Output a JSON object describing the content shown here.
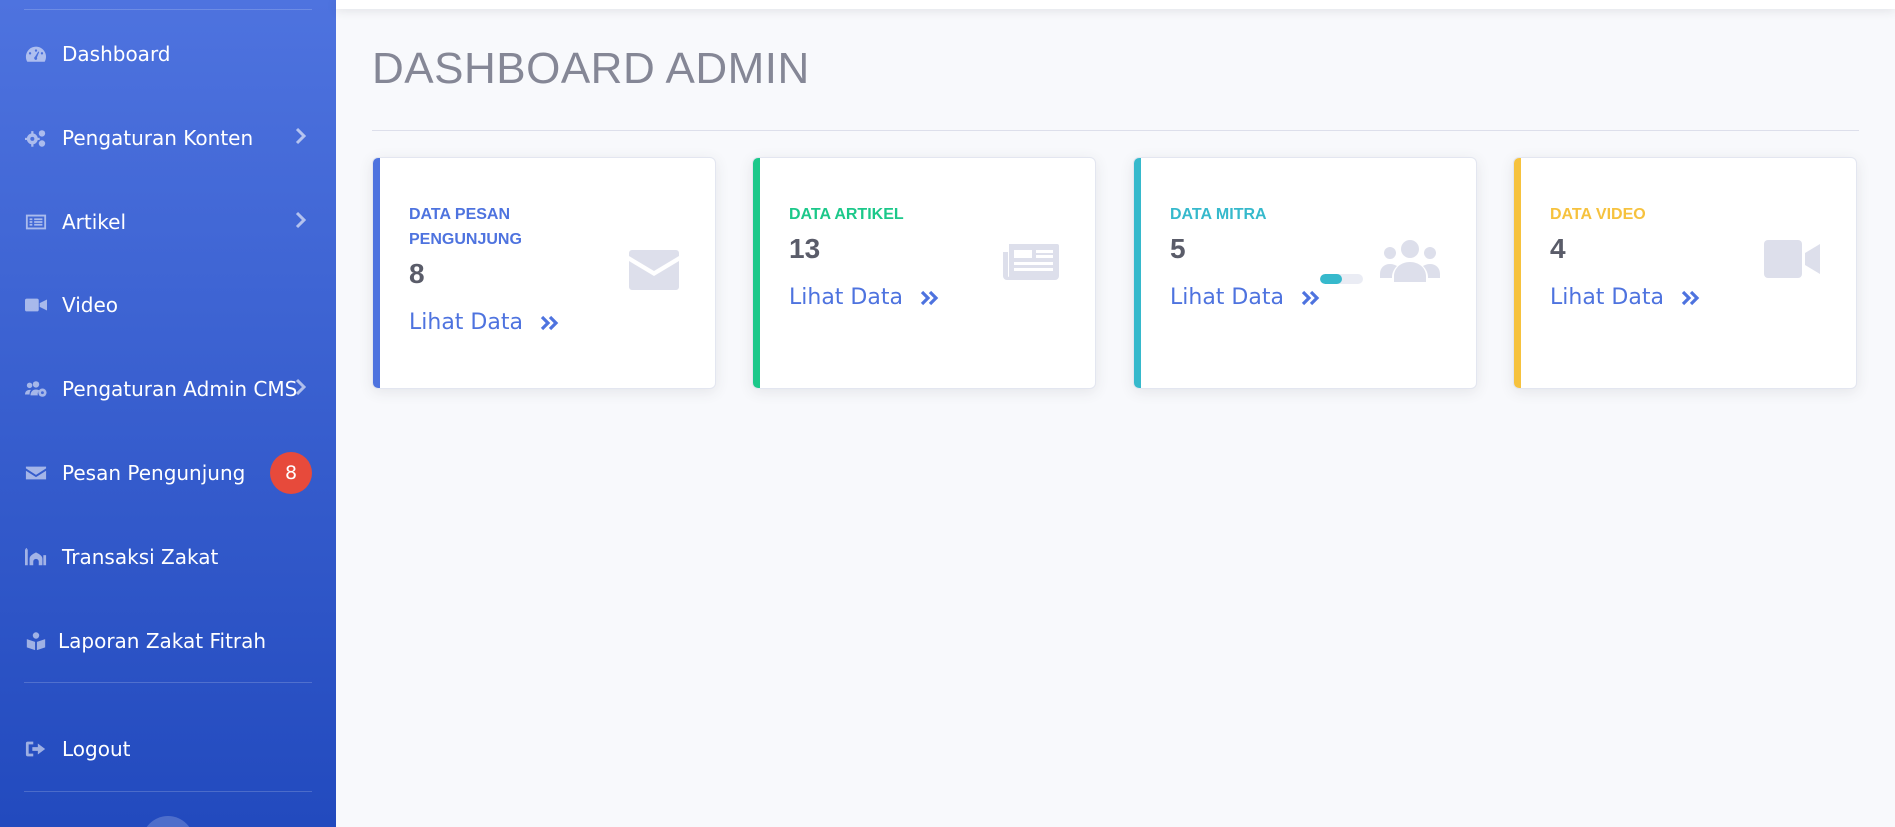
{
  "sidebar": {
    "items": [
      {
        "label": "Dashboard",
        "icon": "tachometer-icon"
      },
      {
        "label": "Pengaturan Konten",
        "icon": "cogs-icon",
        "has_submenu": true
      },
      {
        "label": "Artikel",
        "icon": "list-alt-icon",
        "has_submenu": true
      },
      {
        "label": "Video",
        "icon": "video-icon"
      },
      {
        "label": "Pengaturan Admin CMS",
        "icon": "users-cog-icon",
        "has_submenu": true
      },
      {
        "label": "Pesan Pengunjung",
        "icon": "envelope-icon",
        "badge": "8"
      },
      {
        "label": "Transaksi Zakat",
        "icon": "mosque-icon"
      },
      {
        "label": "Laporan Zakat Fitrah",
        "icon": "book-reader-icon"
      },
      {
        "label": "Logout",
        "icon": "sign-out-icon"
      }
    ]
  },
  "page": {
    "title": "DASHBOARD ADMIN"
  },
  "cards": [
    {
      "title": "DATA PESAN PENGUNJUNG",
      "value": "8",
      "link": "Lihat Data",
      "color": "#4e73df",
      "icon": "envelope-icon"
    },
    {
      "title": "DATA ARTIKEL",
      "value": "13",
      "link": "Lihat Data",
      "color": "#1cc88a",
      "icon": "newspaper-icon"
    },
    {
      "title": "DATA MITRA",
      "value": "5",
      "link": "Lihat Data",
      "color": "#36b9cc",
      "icon": "users-icon",
      "progress_fraction": 0.5
    },
    {
      "title": "DATA VIDEO",
      "value": "4",
      "link": "Lihat Data",
      "color": "#f6c23e",
      "icon": "video-icon"
    }
  ]
}
